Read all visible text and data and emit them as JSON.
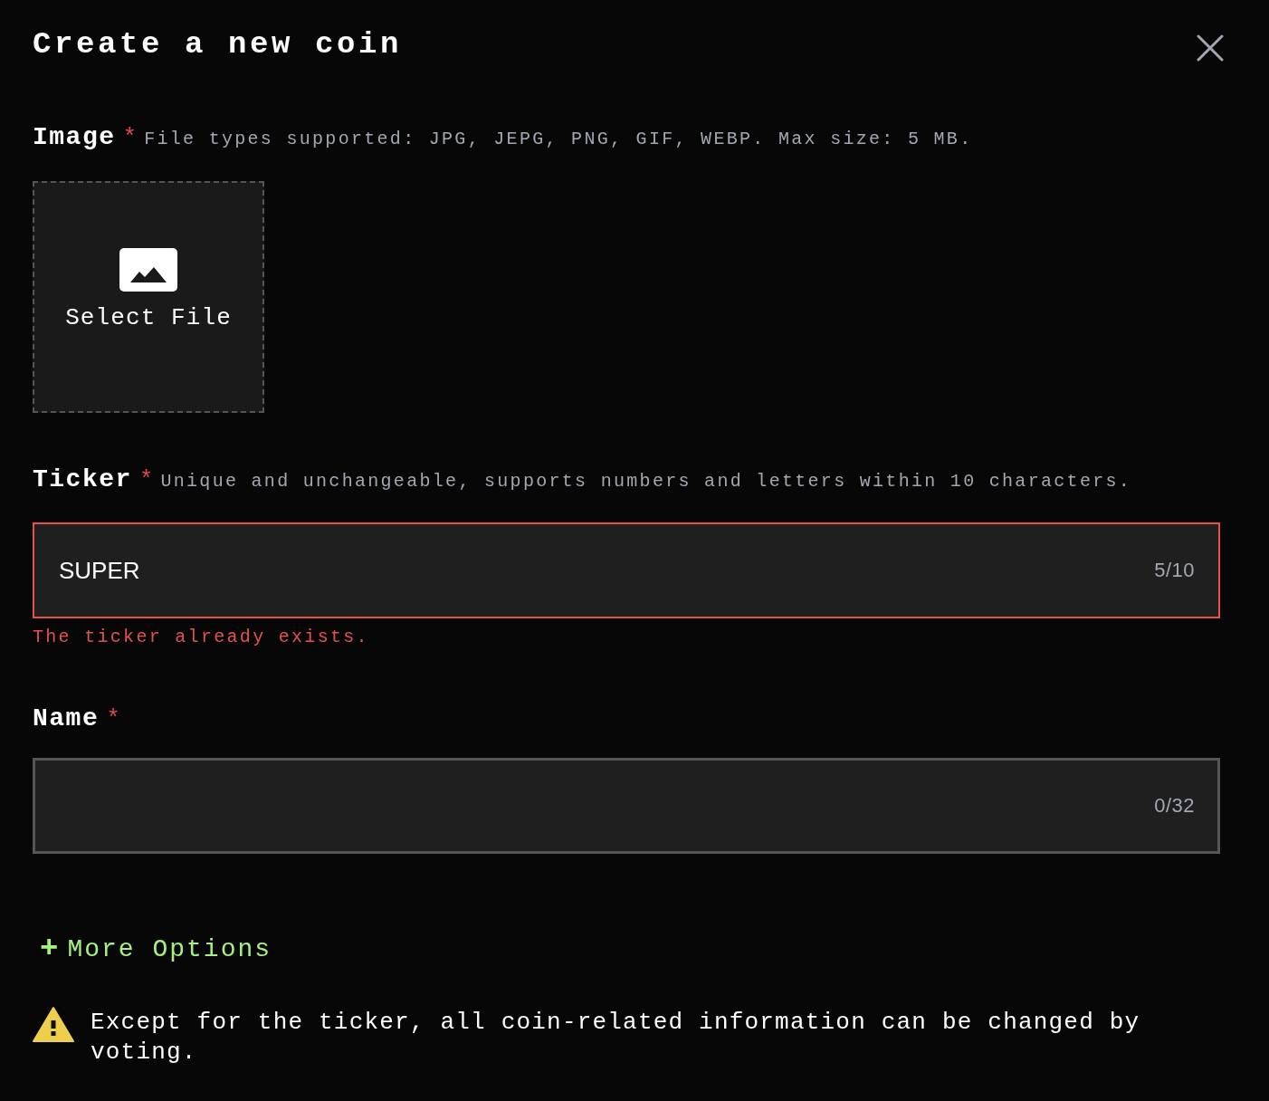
{
  "dialog": {
    "title": "Create a new coin"
  },
  "image": {
    "label": "Image",
    "required_mark": "*",
    "hint": "File types supported: JPG, JEPG, PNG, GIF, WEBP. Max size: 5 MB.",
    "button": "Select File"
  },
  "fields": [
    {
      "label": "Ticker",
      "required_mark": "*",
      "hint": "Unique and unchangeable, supports numbers and letters within 10 characters.",
      "value": "SUPER",
      "counter": "5/10",
      "error": true,
      "error_text": "The ticker already exists."
    },
    {
      "label": "Name",
      "required_mark": "*",
      "counter": "0/32",
      "error": false
    }
  ],
  "more_options": {
    "icon": "+",
    "label": "More Options"
  },
  "notice": "Except for the ticker, all coin-related information can be changed by voting."
}
